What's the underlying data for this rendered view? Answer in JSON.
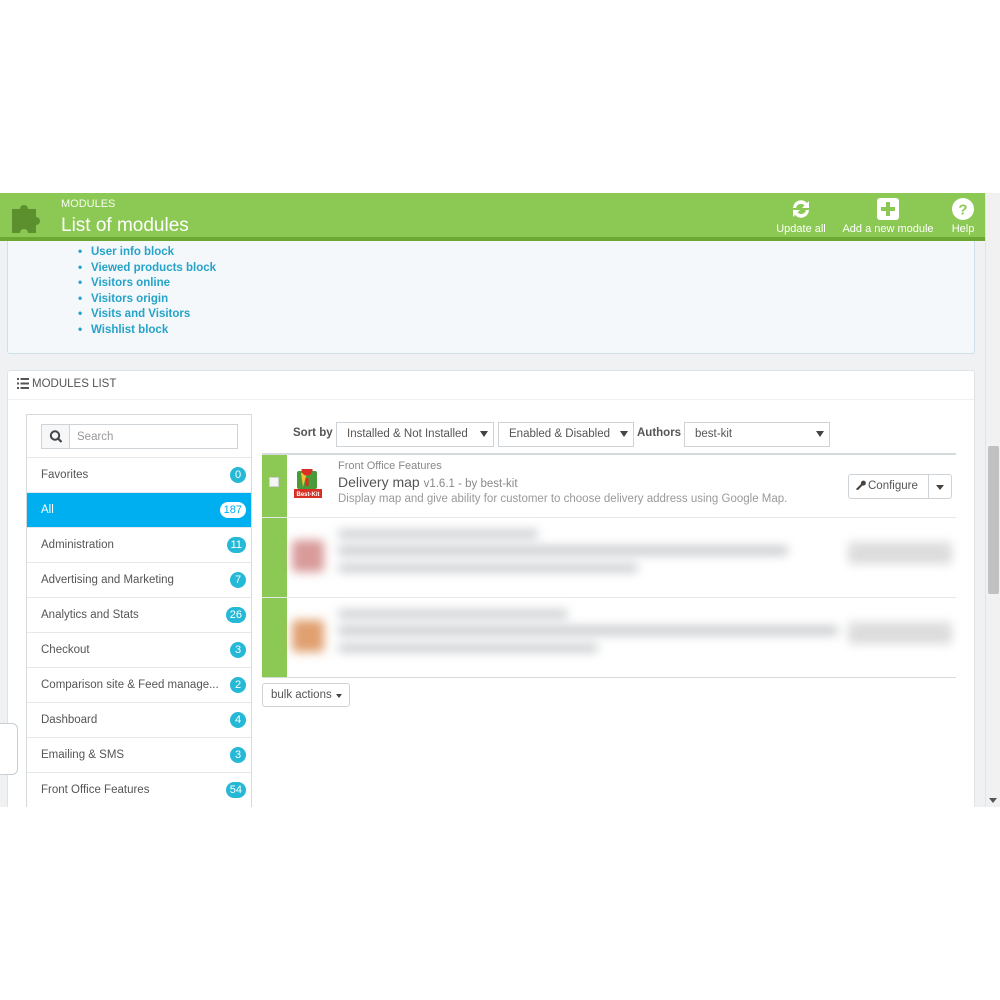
{
  "header": {
    "breadcrumb": "MODULES",
    "title": "List of modules",
    "buttons": {
      "update_all": "Update all",
      "add_module": "Add a new module",
      "help": "Help"
    }
  },
  "info_panel": {
    "modules": [
      "User info block",
      "Viewed products block",
      "Visitors online",
      "Visitors origin",
      "Visits and Visitors",
      "Wishlist block"
    ]
  },
  "modules_list": {
    "heading": "MODULES LIST",
    "search": {
      "placeholder": "Search",
      "value": ""
    },
    "categories": [
      {
        "label": "Favorites",
        "count": "0"
      },
      {
        "label": "All",
        "count": "187"
      },
      {
        "label": "Administration",
        "count": "11"
      },
      {
        "label": "Advertising and Marketing",
        "count": "7"
      },
      {
        "label": "Analytics and Stats",
        "count": "26"
      },
      {
        "label": "Checkout",
        "count": "3"
      },
      {
        "label": "Comparison site & Feed manage...",
        "count": "2"
      },
      {
        "label": "Dashboard",
        "count": "4"
      },
      {
        "label": "Emailing & SMS",
        "count": "3"
      },
      {
        "label": "Front Office Features",
        "count": "54"
      }
    ],
    "active_category": "All",
    "filters": {
      "sort_label": "Sort by",
      "install_filter": "Installed & Not Installed",
      "status_filter": "Enabled & Disabled",
      "authors_label": "Authors",
      "authors_value": "best-kit"
    },
    "module": {
      "category": "Front Office Features",
      "name": "Delivery map",
      "version": "v1.6.1 - by best-kit",
      "description": "Display map and give ability for customer to choose delivery address using Google Map.",
      "configure_label": "Configure",
      "logo_text": "Best-Kit"
    },
    "bulk_actions_label": "bulk actions"
  },
  "colors": {
    "header_green": "#8bc954",
    "active_blue": "#00aff0",
    "badge_blue": "#25b9d7",
    "link_blue": "#25a3c8"
  }
}
